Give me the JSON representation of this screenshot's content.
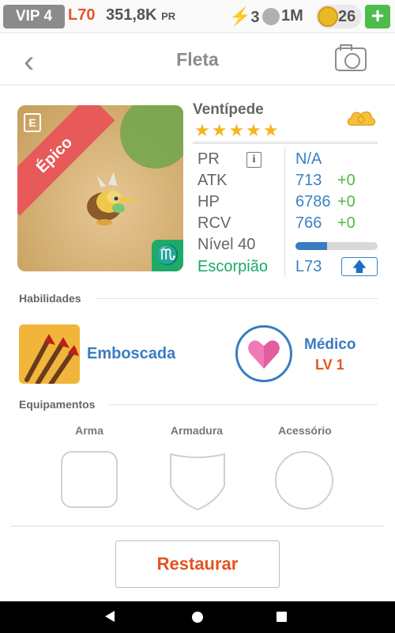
{
  "status_bar": {
    "vip": "VIP 4",
    "level": "L70",
    "power": "351,8K",
    "power_unit": "PR",
    "energy": "3",
    "paw_count": "1M",
    "coins": "26",
    "add_label": "+"
  },
  "header": {
    "title": "Fleta",
    "back_icon": "chevron-left-icon",
    "camera_icon": "camera-icon"
  },
  "monster": {
    "rarity": "Épico",
    "name": "Ventípede",
    "stars": 5,
    "stars_text": "★★★★★",
    "zodiac_symbol": "♏",
    "stats": {
      "pr_label": "PR",
      "pr_value": "N/A",
      "atk_label": "ATK",
      "atk_value": "713",
      "atk_bonus": "+0",
      "hp_label": "HP",
      "hp_value": "6786",
      "hp_bonus": "+0",
      "rcv_label": "RCV",
      "rcv_value": "766",
      "rcv_bonus": "+0",
      "level_label": "Nível 40",
      "level_progress": 0.38,
      "zodiac_label": "Escorpião",
      "zodiac_level": "L73"
    },
    "info_label": "i",
    "upgrade_arrow": "🡅"
  },
  "skills": {
    "title": "Habilidades",
    "active": {
      "name": "Emboscada",
      "icon": "arrows-icon"
    },
    "passive": {
      "name": "Médico",
      "level": "LV 1",
      "icon": "heart-icon"
    }
  },
  "equipment": {
    "title": "Equipamentos",
    "slots": [
      "Arma",
      "Armadura",
      "Acessório"
    ]
  },
  "actions": {
    "restore_label": "Restaurar"
  },
  "colors": {
    "accent_blue": "#3a7cc0",
    "accent_orange": "#e4531f",
    "bonus_green": "#54b845",
    "epic_red": "#e75a59",
    "zodiac_green": "#1aa86a"
  }
}
